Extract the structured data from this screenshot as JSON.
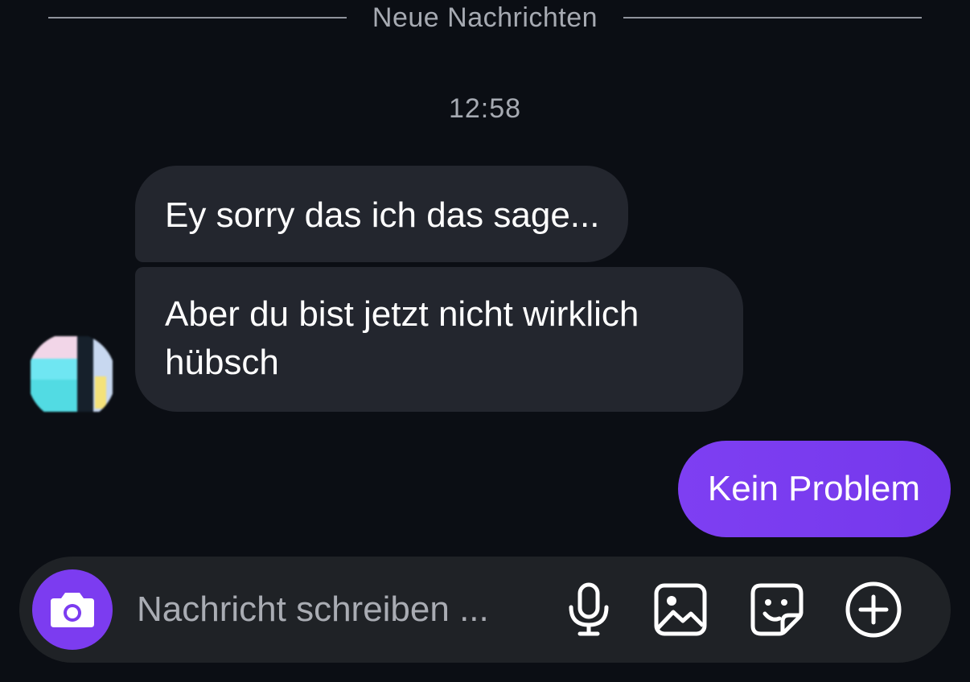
{
  "divider": {
    "label": "Neue Nachrichten"
  },
  "timestamp": "12:58",
  "messages": [
    {
      "direction": "incoming",
      "text": "Ey sorry das ich das sage..."
    },
    {
      "direction": "incoming",
      "text": "Aber du bist jetzt nicht wirklich hübsch"
    },
    {
      "direction": "outgoing",
      "text": "Kein Problem"
    }
  ],
  "composer": {
    "placeholder": "Nachricht schreiben ...",
    "value": "",
    "icons": [
      "camera-icon",
      "microphone-icon",
      "gallery-icon",
      "sticker-icon",
      "plus-circle-icon"
    ]
  },
  "colors": {
    "background": "#0b0e14",
    "incoming_bubble": "#23262e",
    "outgoing_bubble": "#7a3cf0",
    "accent": "#7c3cf0",
    "composer_bg": "#1f2226"
  }
}
